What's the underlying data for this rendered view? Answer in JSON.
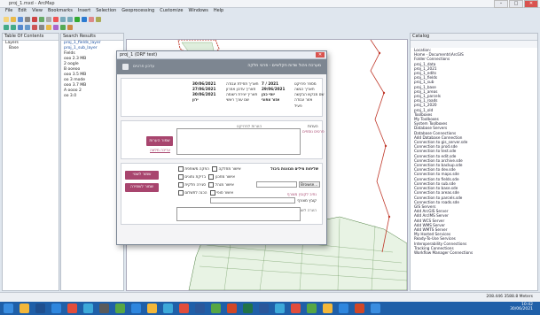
{
  "window": {
    "title": "proj_1.mxd - ArcMap",
    "buttons": [
      "–",
      "□",
      "✕"
    ]
  },
  "menu": [
    "File",
    "Edit",
    "View",
    "Bookmarks",
    "Insert",
    "Selection",
    "Geoprocessing",
    "Customize",
    "Windows",
    "Help"
  ],
  "left_panel": {
    "toc_title": "Table Of Contents",
    "toc_items": [
      "Layers",
      "Base"
    ],
    "search_title": "Search Results",
    "search_items": [
      "proj_1_fields_layer",
      "proj_1_sub_layer",
      "Fields",
      "ooo 2.3 MB",
      "2 oogle",
      "B ooeoo",
      "ooo 3.5 MB",
      "oo 3 mode",
      "ooo 3.7 MB",
      "A oooo 2",
      "oo 3.0"
    ]
  },
  "dialog": {
    "title": "proj_1 (DRF test)",
    "close": "✕",
    "header_text": "מערכת ניהול שדות חקלאיים - פרטי חלקה",
    "header_sub": "עדכון פרטים",
    "info_left": [
      {
        "label": "תאריך תחילת עבודה",
        "value": "30/06/2021"
      },
      {
        "label": "תאריך עדכון אחרון",
        "value": "27/06/2021"
      },
      {
        "label": "תאריך יצירת רשומה",
        "value": "30/06/2021"
      },
      {
        "label": "שם עורך ראשי",
        "value": "ירון"
      }
    ],
    "info_right": [
      {
        "label": "מספר פרויקט",
        "value": "7 / 2021"
      },
      {
        "label": "תאריך הגשה",
        "value": "29/06/2021"
      },
      {
        "label": "שם מבקש הבקשה",
        "value": "יוסי כהן"
      },
      {
        "label": "אזור עבודה",
        "value": "אזור צפוני"
      },
      {
        "label": "סטטוס",
        "value": "פעיל"
      }
    ],
    "notes_label": "הערות",
    "notes_sublabel": "הערות לפרויקט",
    "notes_extra": "פרטים נוספים",
    "save_button": "שמור הערות",
    "save_link": "עריכה מלאה",
    "permissions_title": "שליחות מילים מגוונות ביבול",
    "permissions_rows": [
      {
        "label": "אישור מחלקה",
        "col2": "הפקה משותפת"
      },
      {
        "label": "אישור מתכנן",
        "col2": "בדיקת נתונים"
      },
      {
        "label": "אישור מנהל",
        "col2": "סגירה חלקית"
      },
      {
        "label": "אישור סופי",
        "col2": "הכנה לתשלום"
      }
    ],
    "browse_button": "Browse...",
    "path_label": "נתיב לקובץ מצורף",
    "file_label": "קובץ מצורף",
    "btn_attach": "שמור לשנוי",
    "btn_update": "שמור לשמירה",
    "bottom_note": "הערה לשמירת הנתונים בטבלה"
  },
  "catalog": {
    "title": "Catalog",
    "location": "Location:",
    "items": [
      "Home - Documents\\ArcGIS",
      "Folder Connections",
      "proj_1_data",
      "proj_1_2021",
      "proj_1_edits",
      "proj_1_fields",
      "proj_1_sub",
      "proj_1_base",
      "proj_1_areas",
      "proj_1_parcels",
      "proj_1_roads",
      "proj_1_2020",
      "proj_1_old",
      "Toolboxes",
      "My Toolboxes",
      "System Toolboxes",
      "Database Servers",
      "Database Connections",
      "Add Database Connection",
      "Connection to gis_server.sde",
      "Connection to prod.sde",
      "Connection to test.sde",
      "Connection to edit.sde",
      "Connection to archive.sde",
      "Connection to backup.sde",
      "Connection to dev.sde",
      "Connection to maps.sde",
      "Connection to fields.sde",
      "Connection to sub.sde",
      "Connection to base.sde",
      "Connection to areas.sde",
      "Connection to parcels.sde",
      "Connection to roads.sde",
      "GIS Servers",
      "Add ArcGIS Server",
      "Add ArcIMS Server",
      "Add WCS Server",
      "Add WMS Server",
      "Add WMTS Server",
      "My Hosted Services",
      "Ready-To-Use Services",
      "Interoperability Connections",
      "Tracking Connections",
      "Workflow Manager Connections"
    ],
    "tabs": [
      "Catalog",
      "Search"
    ]
  },
  "status": {
    "coords": "208.446  3588.8 Meters"
  },
  "taskbar": {
    "time": "10:42",
    "date": "30/06/2021"
  },
  "colors": {
    "accent": "#a8456e",
    "header": "#7d8691",
    "taskbar": "#1f5fa8"
  }
}
